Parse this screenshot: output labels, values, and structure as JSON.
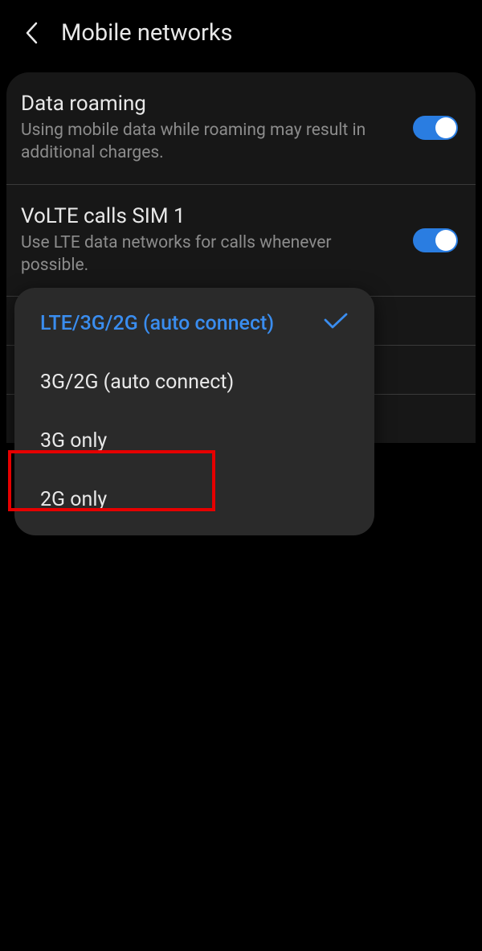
{
  "header": {
    "title": "Mobile networks"
  },
  "settings": {
    "roaming": {
      "title": "Data roaming",
      "description": "Using mobile data while roaming may result in additional charges.",
      "enabled": true
    },
    "volte": {
      "title": "VoLTE calls SIM 1",
      "description": "Use LTE data networks for calls whenever possible.",
      "enabled": true
    }
  },
  "dropdown": {
    "options": [
      {
        "label": "LTE/3G/2G (auto connect)",
        "selected": true
      },
      {
        "label": "3G/2G (auto connect)",
        "selected": false
      },
      {
        "label": "3G only",
        "selected": false
      },
      {
        "label": "2G only",
        "selected": false
      }
    ]
  },
  "annotation": {
    "highlight_target": "2G only"
  },
  "colors": {
    "accent": "#2a7de1",
    "selected": "#3a8def",
    "highlight": "#e60000"
  }
}
